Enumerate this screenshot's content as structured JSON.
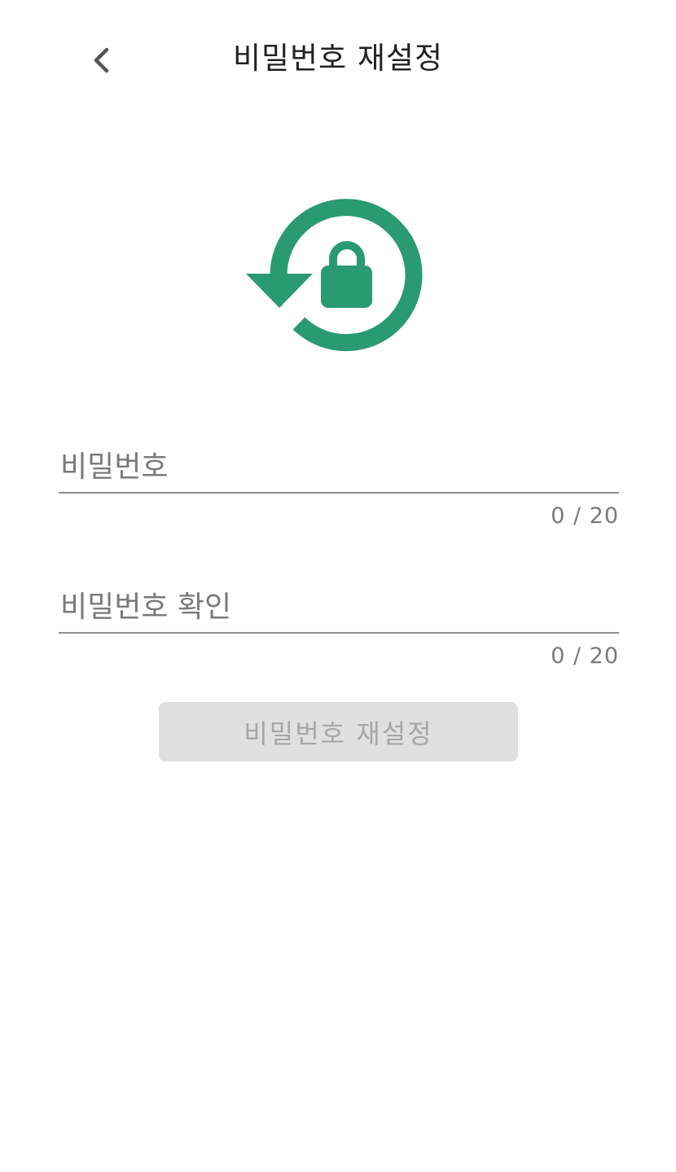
{
  "header": {
    "title": "비밀번호 재설정",
    "back_icon": "chevron-left-icon"
  },
  "hero": {
    "icon": "lock-reset-icon",
    "color": "#2a9a73"
  },
  "form": {
    "password": {
      "placeholder": "비밀번호",
      "value": "",
      "counter": "0 / 20"
    },
    "password_confirm": {
      "placeholder": "비밀번호 확인",
      "value": "",
      "counter": "0 / 20"
    }
  },
  "submit": {
    "label": "비밀번호 재설정",
    "enabled": false,
    "background": "#e0e0e0",
    "text_color": "#a6a6a6"
  }
}
